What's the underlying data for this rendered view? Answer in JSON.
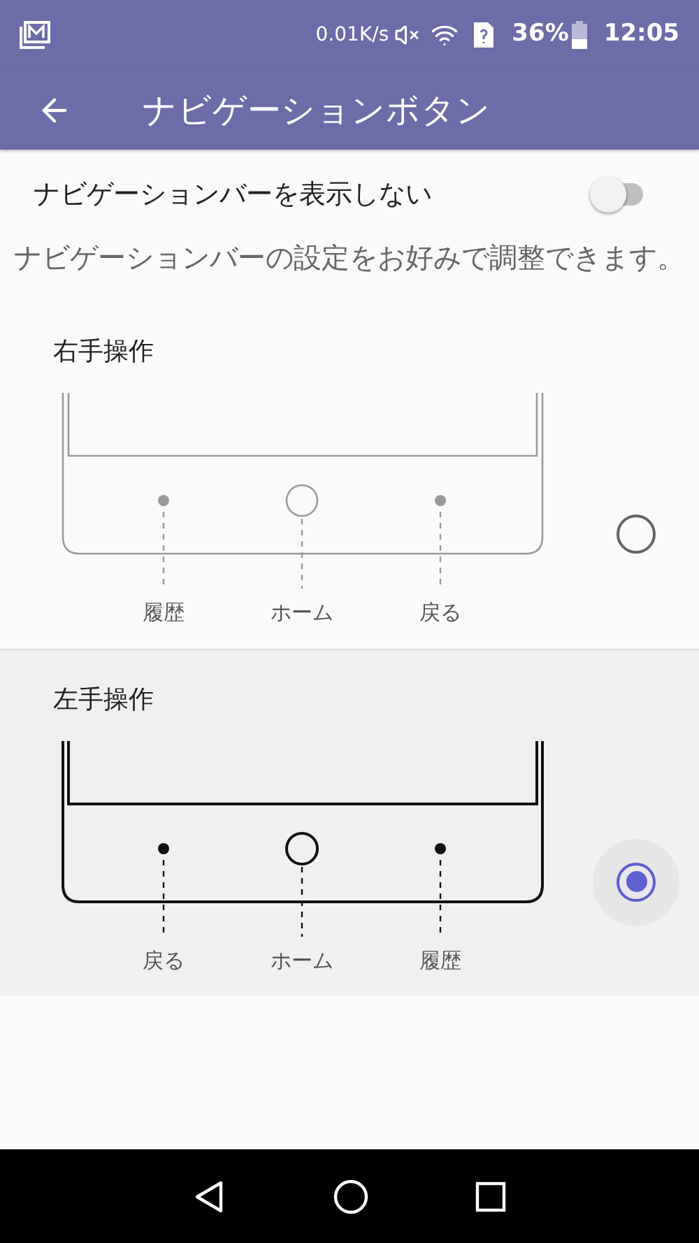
{
  "status_bar": {
    "speed": "0.01K/s",
    "battery": "36%",
    "time": "12:05"
  },
  "app_bar": {
    "title": "ナビゲーションボタン"
  },
  "hide_nav_bar": {
    "label": "ナビゲーションバーを表示しない",
    "on": false
  },
  "description": "ナビゲーションバーの設定をお好みで調整できます。",
  "options": [
    {
      "title": "右手操作",
      "labels": [
        "履歴",
        "ホーム",
        "戻る"
      ],
      "selected": false
    },
    {
      "title": "左手操作",
      "labels": [
        "戻る",
        "ホーム",
        "履歴"
      ],
      "selected": true
    }
  ]
}
